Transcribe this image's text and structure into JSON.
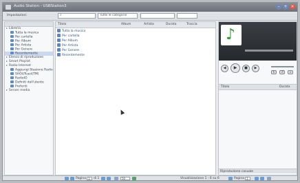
{
  "window": {
    "title": "Audio Station - USBStation3"
  },
  "toolbar": {
    "left_label": "Impostazioni",
    "scope_select": "Tutte le categorie"
  },
  "sidebar": {
    "sections": [
      {
        "label": "Libreria",
        "type": "header"
      },
      {
        "label": "Tutta la musica",
        "type": "item"
      },
      {
        "label": "Per cartella",
        "type": "item"
      },
      {
        "label": "Per Album",
        "type": "item"
      },
      {
        "label": "Per Artista",
        "type": "item"
      },
      {
        "label": "Per Genere",
        "type": "item"
      },
      {
        "label": "Recentemente",
        "type": "item",
        "selected": true
      },
      {
        "label": "Elenco di riproduzione",
        "type": "header"
      },
      {
        "label": "Smart Playlist",
        "type": "header"
      },
      {
        "label": "Radio Internet",
        "type": "header"
      },
      {
        "label": "Aggiungi Stazione Radio",
        "type": "item"
      },
      {
        "label": "SHOUTcast(TM)",
        "type": "item"
      },
      {
        "label": "RadioIO",
        "type": "item"
      },
      {
        "label": "Definiti dall'utente",
        "type": "item"
      },
      {
        "label": "Preferiti",
        "type": "item"
      },
      {
        "label": "Server media",
        "type": "header"
      }
    ]
  },
  "main": {
    "columns": [
      "Titolo",
      "Album",
      "Artista",
      "Durata",
      "Traccia"
    ],
    "rows": [
      "Tutta la musica",
      "Per cartella",
      "Per Album",
      "Per Artista",
      "Per Genere",
      "Recentemente"
    ]
  },
  "player": {
    "queue_header_title": "Titolo",
    "queue_header_duration": "Durata",
    "queue_footer": "Riproduzione casuale"
  },
  "status": {
    "page_label": "Pagina",
    "page_value": "1",
    "of_label": "di 1",
    "per_page_value": "50",
    "items_info": "Visualizzazione 1 - 6 su 6",
    "right_page_label": "Pagina",
    "right_page_value": "1"
  },
  "colors": {
    "accent": "#5e8bc9",
    "titlebar": "#6b7079",
    "player_art": "#26292d",
    "note_green": "#3a9b3c"
  },
  "icons": {
    "music_note": "music-note-icon"
  }
}
